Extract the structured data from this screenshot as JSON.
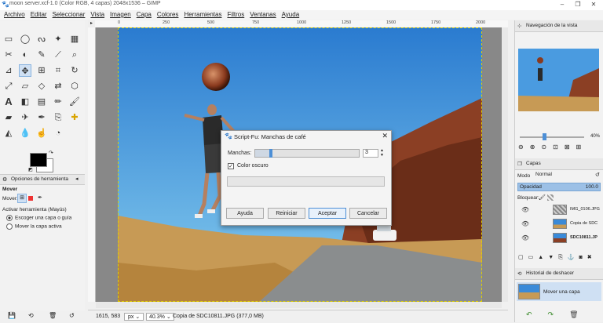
{
  "window": {
    "title": "moon server.xcf-1.0 (Color RGB, 4 capas) 2048x1536 – GIMP",
    "controls": [
      "–",
      "❐",
      "✕"
    ]
  },
  "menu": [
    "Archivo",
    "Editar",
    "Seleccionar",
    "Vista",
    "Imagen",
    "Capa",
    "Colores",
    "Herramientas",
    "Filtros",
    "Ventanas",
    "Ayuda"
  ],
  "toolbox": {
    "tool_options_tab": "Opciones de herramienta",
    "move_title": "Mover",
    "move_label": "Mover:",
    "activate_label": "Activar herramienta (Mayús)",
    "option_pick": "Escoger una capa o guía",
    "option_active": "Mover la capa activa"
  },
  "rulers": {
    "top": [
      "0",
      "250",
      "500",
      "750",
      "1000",
      "1250",
      "1500",
      "1750",
      "2000"
    ]
  },
  "dialog": {
    "title": "Script-Fu: Manchas de café",
    "spots_label": "Manchas:",
    "spots_value": "3",
    "spots_fraction": 0.15,
    "dark_label": "Color oscuro",
    "buttons": {
      "help": "Ayuda",
      "reset": "Reiniciar",
      "ok": "Aceptar",
      "cancel": "Cancelar"
    }
  },
  "status": {
    "coords": "1615, 583",
    "unit": "px",
    "zoom": "40.3%",
    "message": "Copia de SDC10811.JPG (377,0 MB)"
  },
  "dock": {
    "nav_tab": "Navegación de la vista",
    "nav_zoom": "40%",
    "layers_tab": "Capas",
    "mode_label": "Modo",
    "mode_value": "Normal",
    "opacity_label": "Opacidad",
    "opacity_value": "100.0",
    "lock_label": "Bloquear:",
    "layers": [
      {
        "name": "IMG_0106.JPG"
      },
      {
        "name": "Copia de SDC"
      },
      {
        "name": "SDC10811.JP"
      }
    ],
    "history_tab": "Historial de deshacer",
    "history_item": "Mover una capa"
  },
  "colors": {
    "accent": "#4d8fd6",
    "sky_top": "#2d7fd0",
    "sky_bottom": "#7ec6ee"
  }
}
